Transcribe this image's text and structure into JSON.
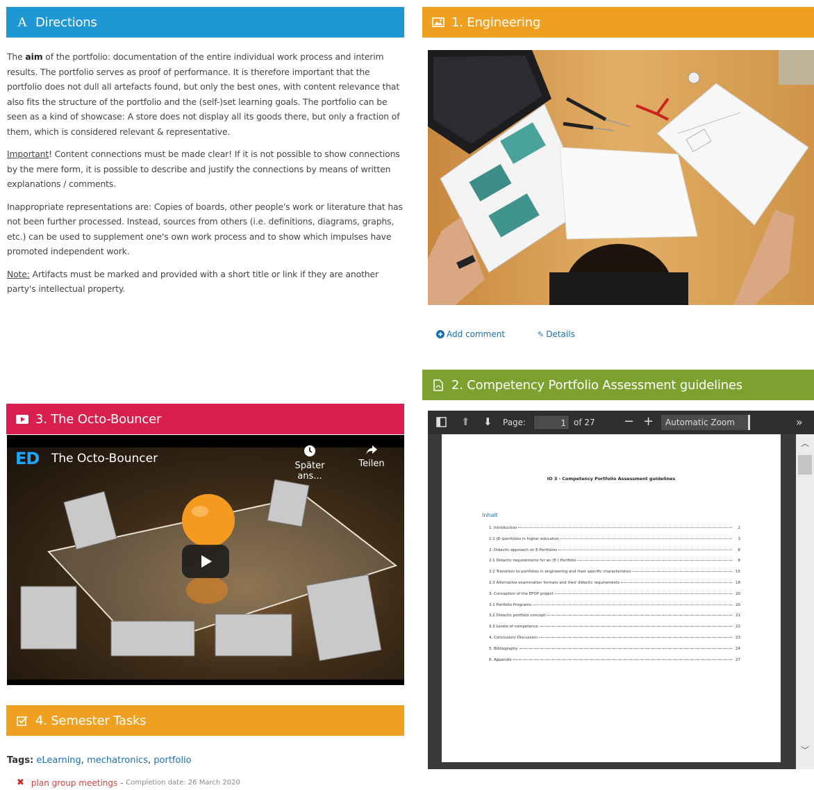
{
  "directions": {
    "icon": "letter-a-icon",
    "title": "Directions",
    "color": "#1f97d4",
    "p1_pre": "The ",
    "p1_bold": "aim",
    "p1_post": " of the portfolio: documentation of the entire individual work process and interim results. The portfolio serves as proof of performance.  It is therefore important that the portfolio does not dull all artefacts found, but only the best ones, with content relevance that also fits the structure of the portfolio and the (self-)set learning goals. The portfolio can be seen as a kind of showcase: A store does not display all its goods there, but only a fraction of them, which is considered relevant & representative.",
    "p2_label": "Important",
    "p2_text": "! Content connections must be made clear! If it is not possible to show connections by the mere form, it is possible to describe and justify the connections by means of written explanations / comments.",
    "p3": "Inappropriate representations are: Copies of boards, other people's work or literature that has not been further processed. Instead, sources from others (i.e. definitions, diagrams, graphs, etc.) can be used to supplement one's own work process and to show which impulses have promoted independent work.",
    "p4_label": "Note:",
    "p4_text": " Artifacts must be marked and provided with a short title or link if they are another party's intellectual property."
  },
  "engineering": {
    "icon": "image-icon",
    "title": "1. Engineering",
    "color": "#f0a020",
    "add_comment": "Add comment",
    "details": "Details"
  },
  "competency": {
    "icon": "pdf-file-icon",
    "title": "2. Competency Portfolio Assessment guidelines",
    "color": "#7ca12f",
    "toolbar": {
      "page_label": "Page:",
      "page_value": "1",
      "page_total": "of 27",
      "zoom": "Automatic Zoom"
    },
    "doc_title": "IO 3 -  Competency Portfolio Assessment guidelines",
    "toc_heading": "Inhalt",
    "toc": [
      {
        "t": "1. Introduction",
        "n": "2"
      },
      {
        "t": "1.1      (E-)portfolios in higher education",
        "n": "3"
      },
      {
        "t": "2. Didactic approach on E-Portfolios",
        "n": "8"
      },
      {
        "t": "2.1 Didactic requirements for an (E-) Portfolio",
        "n": "8"
      },
      {
        "t": "2.2 Transition to portfolios in engineering and their specific characteristics",
        "n": "15"
      },
      {
        "t": "2.3 Alternative examination formats and their didactic requirements",
        "n": "18"
      },
      {
        "t": "3. Conception of the EFOP project",
        "n": "20"
      },
      {
        "t": "3.1 Portfolio Programs",
        "n": "20"
      },
      {
        "t": "3.2 Didactic portfolio concept",
        "n": "21"
      },
      {
        "t": "3.3 Levels of competence",
        "n": "22"
      },
      {
        "t": "4. Conclusion/ Discussion",
        "n": "23"
      },
      {
        "t": "5. Bibliography",
        "n": "24"
      },
      {
        "t": "6. Appendix",
        "n": "27"
      }
    ]
  },
  "octo": {
    "icon": "video-icon",
    "title": "3. The Octo-Bouncer",
    "color": "#d81f4e",
    "channel_logo": "ED",
    "video_title": "The Octo-Bouncer",
    "watch_later": "Später ans...",
    "share": "Teilen"
  },
  "tasks": {
    "icon": "checkbox-icon",
    "title": "4. Semester Tasks",
    "color": "#f0a020",
    "tags_label": "Tags:",
    "tags": [
      "eLearning",
      "mechatronics",
      "portfolio"
    ],
    "task_name": "plan group meetings",
    "task_sep": " - ",
    "task_date": "Completion date: 26 March 2020"
  }
}
